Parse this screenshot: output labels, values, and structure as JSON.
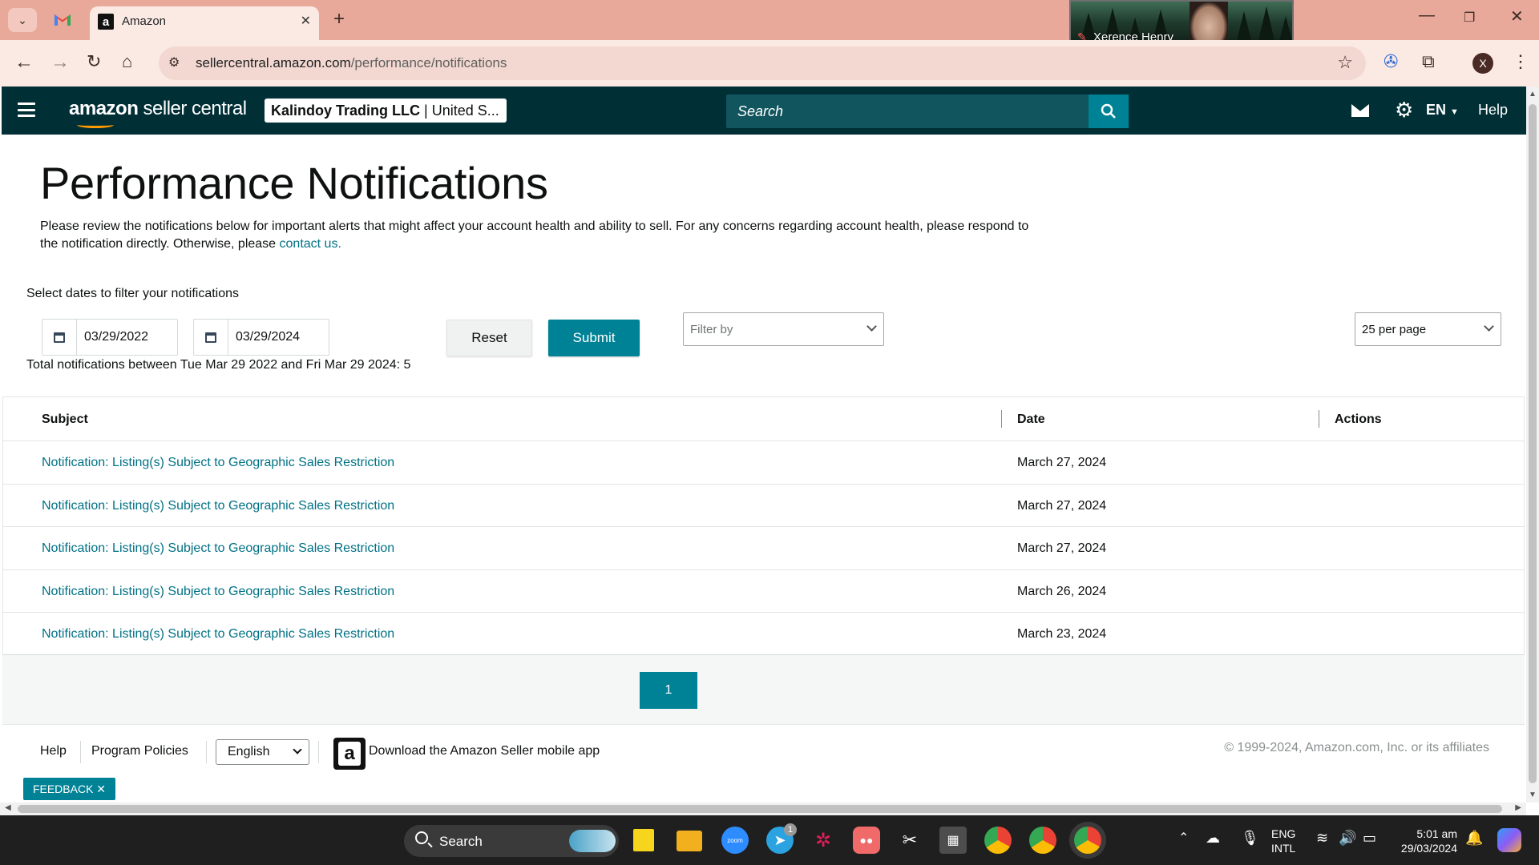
{
  "browser": {
    "tab_title": "Amazon",
    "favicon_letter": "a",
    "url_host": "sellercentral.amazon.com",
    "url_path": "/performance/notifications",
    "profile_initial": "X",
    "video_participant": "Xerence Henry"
  },
  "header": {
    "logo_brand": "amazon",
    "logo_product": " seller central",
    "account_merchant": "Kalindoy Trading LLC",
    "account_marketplace": " | United S...",
    "search_placeholder": "Search",
    "language": "EN",
    "help_label": "Help"
  },
  "page": {
    "title": "Performance Notifications",
    "intro_text": "Please review the notifications below for important alerts that might affect your account health and ability to sell. For any concerns regarding account health, please respond to the notification directly. Otherwise, please ",
    "intro_link": "contact us.",
    "filter_label": "Select dates to filter your notifications",
    "start_date": "03/29/2022",
    "end_date": "03/29/2024",
    "reset_label": "Reset",
    "submit_label": "Submit",
    "filter_by_placeholder": "Filter by",
    "per_page_value": "25 per page",
    "total_line": "Total notifications between Tue Mar 29 2022 and Fri Mar 29 2024: 5"
  },
  "table": {
    "columns": [
      "Subject",
      "Date",
      "Actions"
    ],
    "rows": [
      {
        "subject": "Notification: Listing(s) Subject to Geographic Sales Restriction",
        "date": "March 27, 2024"
      },
      {
        "subject": "Notification: Listing(s) Subject to Geographic Sales Restriction",
        "date": "March 27, 2024"
      },
      {
        "subject": "Notification: Listing(s) Subject to Geographic Sales Restriction",
        "date": "March 27, 2024"
      },
      {
        "subject": "Notification: Listing(s) Subject to Geographic Sales Restriction",
        "date": "March 26, 2024"
      },
      {
        "subject": "Notification: Listing(s) Subject to Geographic Sales Restriction",
        "date": "March 23, 2024"
      }
    ]
  },
  "pagination": {
    "current_page": "1"
  },
  "footer": {
    "help": "Help",
    "program_policies": "Program Policies",
    "language_select": "English",
    "download_app": "Download the Amazon Seller mobile app",
    "copyright": "© 1999-2024, Amazon.com, Inc. or its affiliates",
    "feedback": "FEEDBACK ✕"
  },
  "taskbar": {
    "search_label": "Search",
    "lang_line1": "ENG",
    "lang_line2": "INTL",
    "time": "5:01 am",
    "date": "29/03/2024",
    "telegram_badge": "1"
  },
  "colors": {
    "header_bg": "#002f36",
    "accent_teal": "#008296",
    "link": "#007185",
    "browser_chrome": "#e8a89a"
  }
}
